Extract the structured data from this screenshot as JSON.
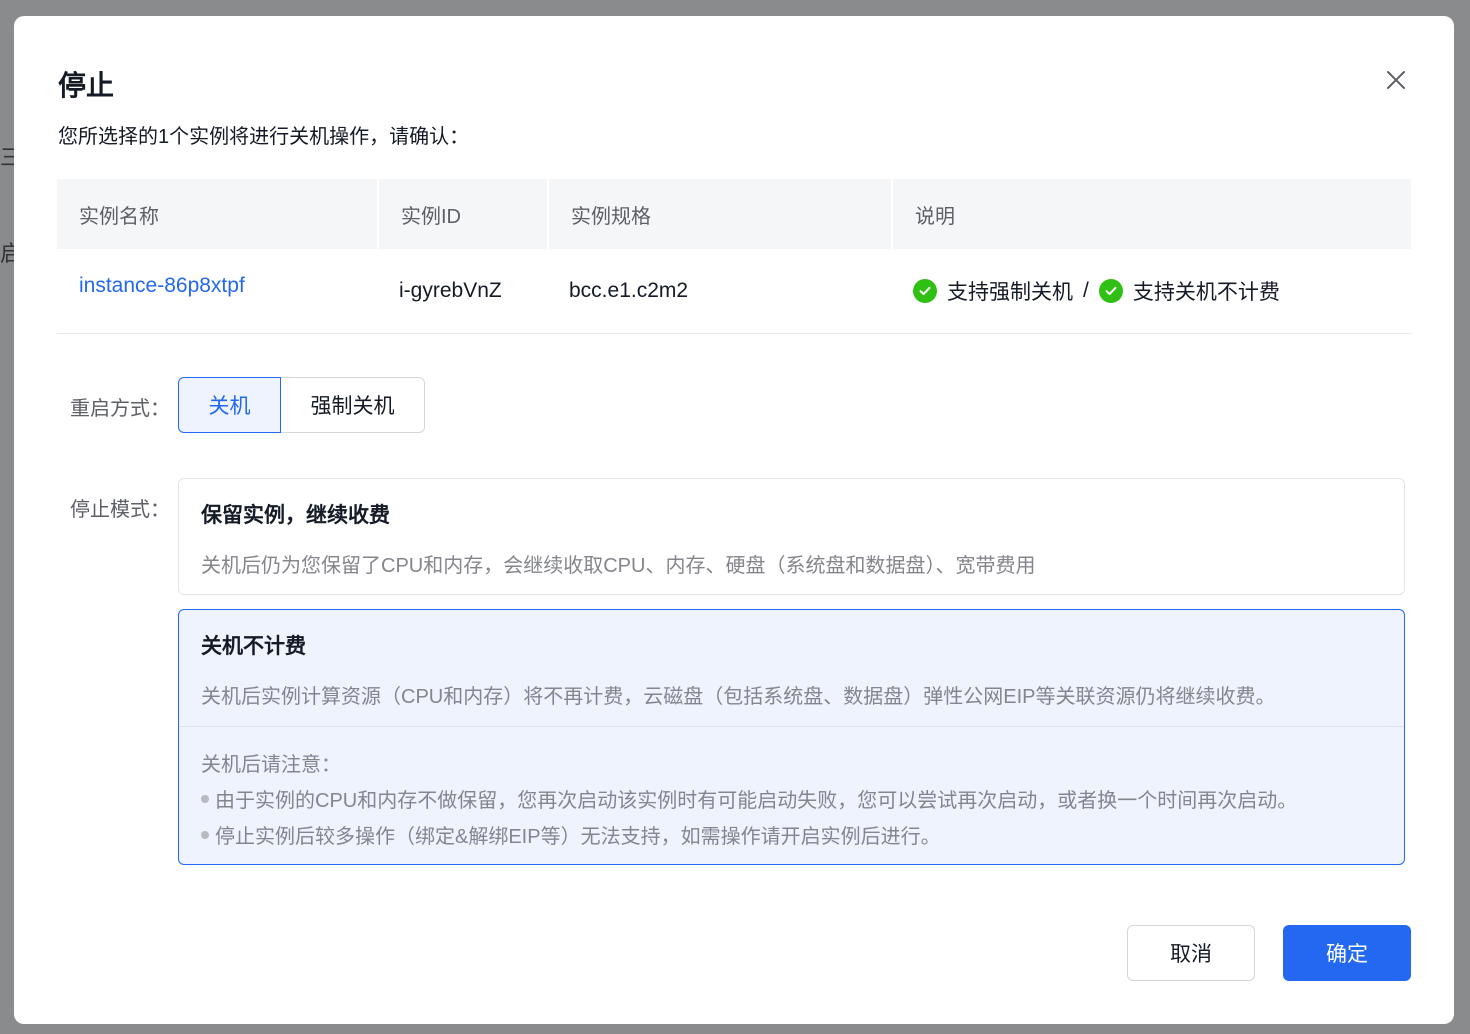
{
  "background": {
    "fragments": [
      "三",
      "启"
    ]
  },
  "dialog": {
    "title": "停止",
    "close_icon": "close-icon",
    "subtitle": "您所选择的1个实例将进行关机操作，请确认："
  },
  "table": {
    "headers": [
      "实例名称",
      "实例ID",
      "实例规格",
      "说明"
    ],
    "row": {
      "name": "instance-86p8xtpf",
      "id": "i-gyrebVnZ",
      "spec": "bcc.e1.c2m2",
      "note_1": "支持强制关机",
      "separator": "/",
      "note_2": "支持关机不计费"
    }
  },
  "restart_mode": {
    "label": "重启方式：",
    "options": [
      "关机",
      "强制关机"
    ],
    "selected": "关机"
  },
  "stop_mode": {
    "label": "停止模式：",
    "keep": {
      "title": "保留实例，继续收费",
      "desc": "关机后仍为您保留了CPU和内存，会继续收取CPU、内存、硬盘（系统盘和数据盘）、宽带费用"
    },
    "no_charge": {
      "title": "关机不计费",
      "desc": "关机后实例计算资源（CPU和内存）将不再计费，云磁盘（包括系统盘、数据盘）弹性公网EIP等关联资源仍将继续收费。",
      "note_title": "关机后请注意：",
      "notes": [
        "由于实例的CPU和内存不做保留，您再次启动该实例时有可能启动失败，您可以尝试再次启动，或者换一个时间再次启动。",
        "停止实例后较多操作（绑定&解绑EIP等）无法支持，如需操作请开启实例后进行。"
      ]
    },
    "selected": "关机不计费"
  },
  "footer": {
    "cancel_label": "取消",
    "ok_label": "确定"
  },
  "colors": {
    "primary": "#2468f2",
    "success": "#30bf13",
    "selected_bg": "#eef3fe"
  }
}
